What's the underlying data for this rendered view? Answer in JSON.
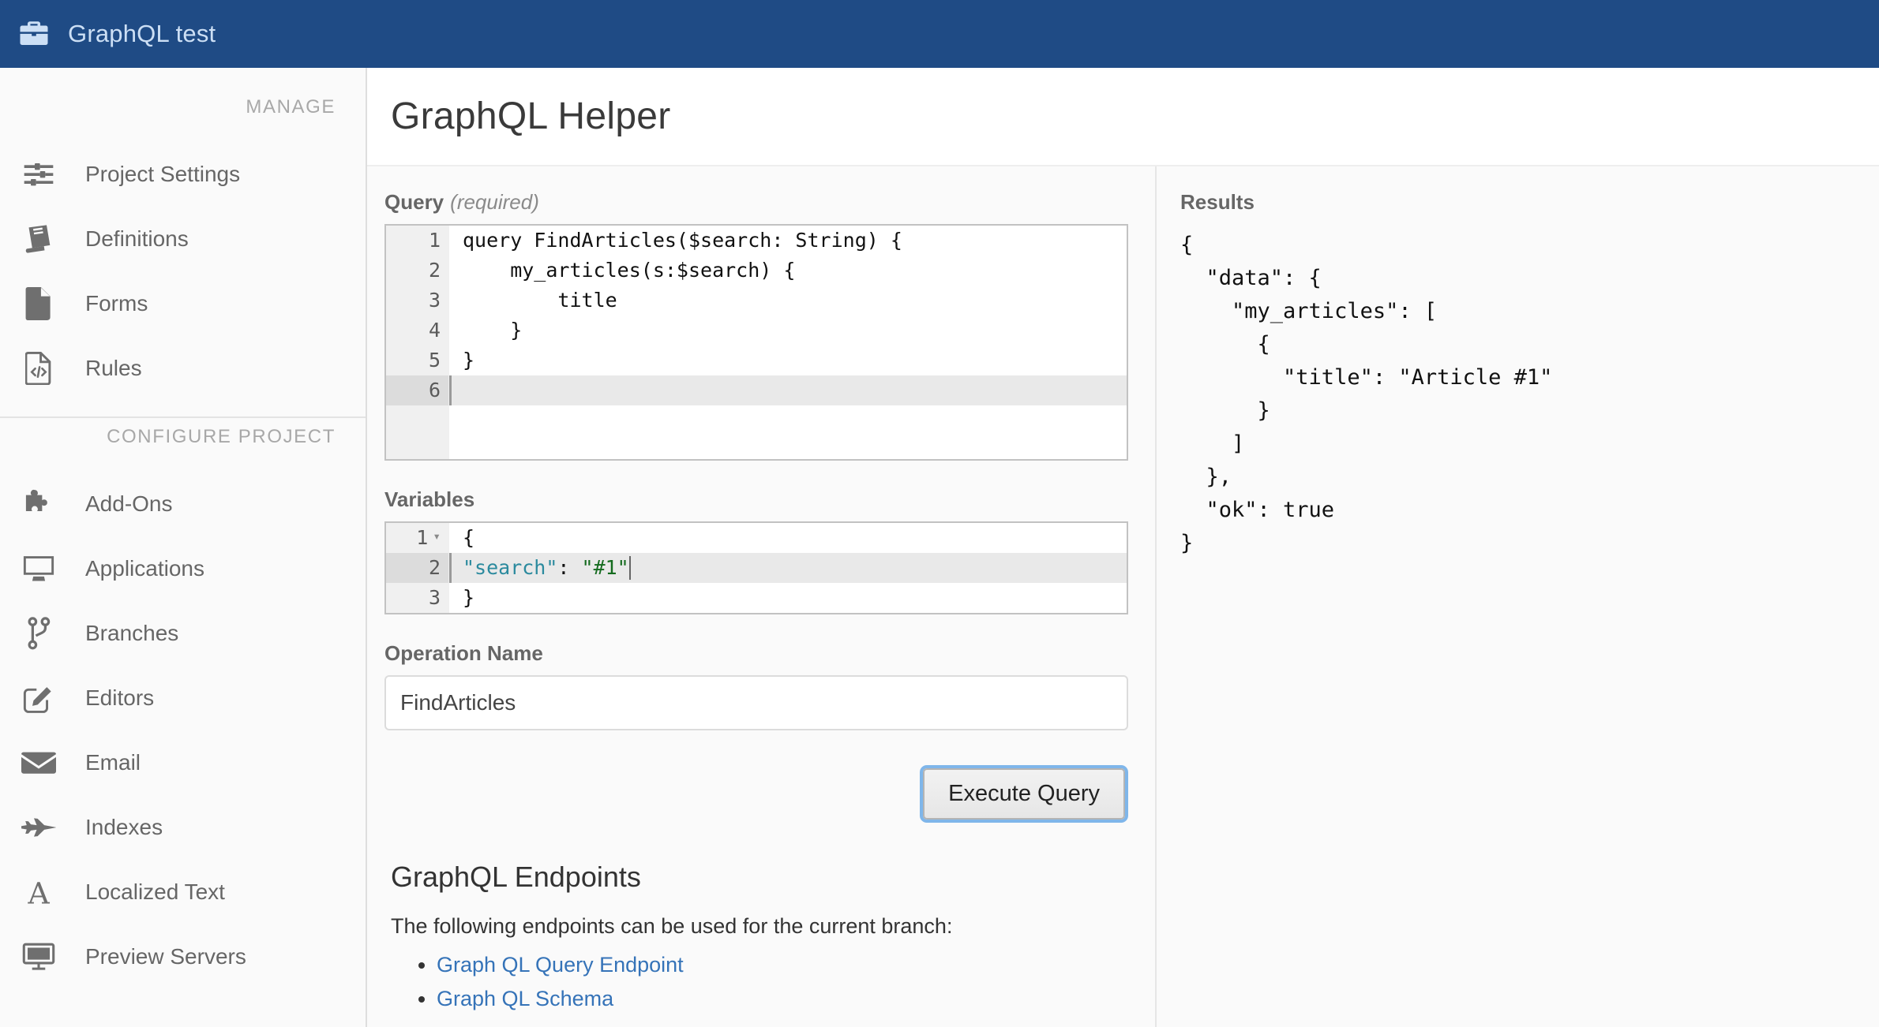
{
  "topbar": {
    "icon": "briefcase-icon",
    "title": "GraphQL test"
  },
  "sidebar": {
    "sections": [
      {
        "heading": "MANAGE",
        "items": [
          {
            "icon": "sliders-icon",
            "label": "Project Settings"
          },
          {
            "icon": "book-icon",
            "label": "Definitions"
          },
          {
            "icon": "document-icon",
            "label": "Forms"
          },
          {
            "icon": "code-file-icon",
            "label": "Rules"
          }
        ]
      },
      {
        "heading": "CONFIGURE PROJECT",
        "items": [
          {
            "icon": "puzzle-icon",
            "label": "Add-Ons"
          },
          {
            "icon": "monitor-icon",
            "label": "Applications"
          },
          {
            "icon": "branch-icon",
            "label": "Branches"
          },
          {
            "icon": "pencil-square-icon",
            "label": "Editors"
          },
          {
            "icon": "envelope-icon",
            "label": "Email"
          },
          {
            "icon": "jet-icon",
            "label": "Indexes"
          },
          {
            "icon": "letter-a-icon",
            "label": "Localized Text"
          },
          {
            "icon": "display-icon",
            "label": "Preview Servers"
          }
        ]
      }
    ]
  },
  "page": {
    "title": "GraphQL Helper"
  },
  "form": {
    "query": {
      "label": "Query",
      "required_note": "(required)",
      "lines": [
        {
          "n": "1",
          "text": "query FindArticles($search: String) {",
          "active": false,
          "fold": false
        },
        {
          "n": "2",
          "text": "    my_articles(s:$search) {",
          "active": false,
          "fold": false
        },
        {
          "n": "3",
          "text": "        title",
          "active": false,
          "fold": false
        },
        {
          "n": "4",
          "text": "    }",
          "active": false,
          "fold": false
        },
        {
          "n": "5",
          "text": "}",
          "active": false,
          "fold": false
        },
        {
          "n": "6",
          "text": "",
          "active": true,
          "fold": false
        }
      ]
    },
    "variables": {
      "label": "Variables",
      "lines": [
        {
          "n": "1",
          "text": "{",
          "active": false,
          "fold": true
        },
        {
          "n": "2",
          "text": "    \"search\": \"#1\"",
          "active": true,
          "fold": false,
          "key": "\"search\"",
          "value": "\"#1\""
        },
        {
          "n": "3",
          "text": "}",
          "active": false,
          "fold": false
        }
      ]
    },
    "operation_name": {
      "label": "Operation Name",
      "value": "FindArticles",
      "placeholder": ""
    },
    "execute_button": "Execute Query"
  },
  "endpoints": {
    "heading": "GraphQL Endpoints",
    "description": "The following endpoints can be used for the current branch:",
    "links": [
      "Graph QL Query Endpoint",
      "Graph QL Schema"
    ]
  },
  "results": {
    "label": "Results",
    "json": "{\n  \"data\": {\n    \"my_articles\": [\n      {\n        \"title\": \"Article #1\"\n      }\n    ]\n  },\n  \"ok\": true\n}"
  },
  "colors": {
    "topbar_bg": "#1f4b85",
    "topbar_text": "#ccdff5",
    "link": "#3573b8",
    "focus_ring": "#7fb6ea",
    "json_key": "#2b8a9e",
    "json_string": "#156b1f"
  }
}
